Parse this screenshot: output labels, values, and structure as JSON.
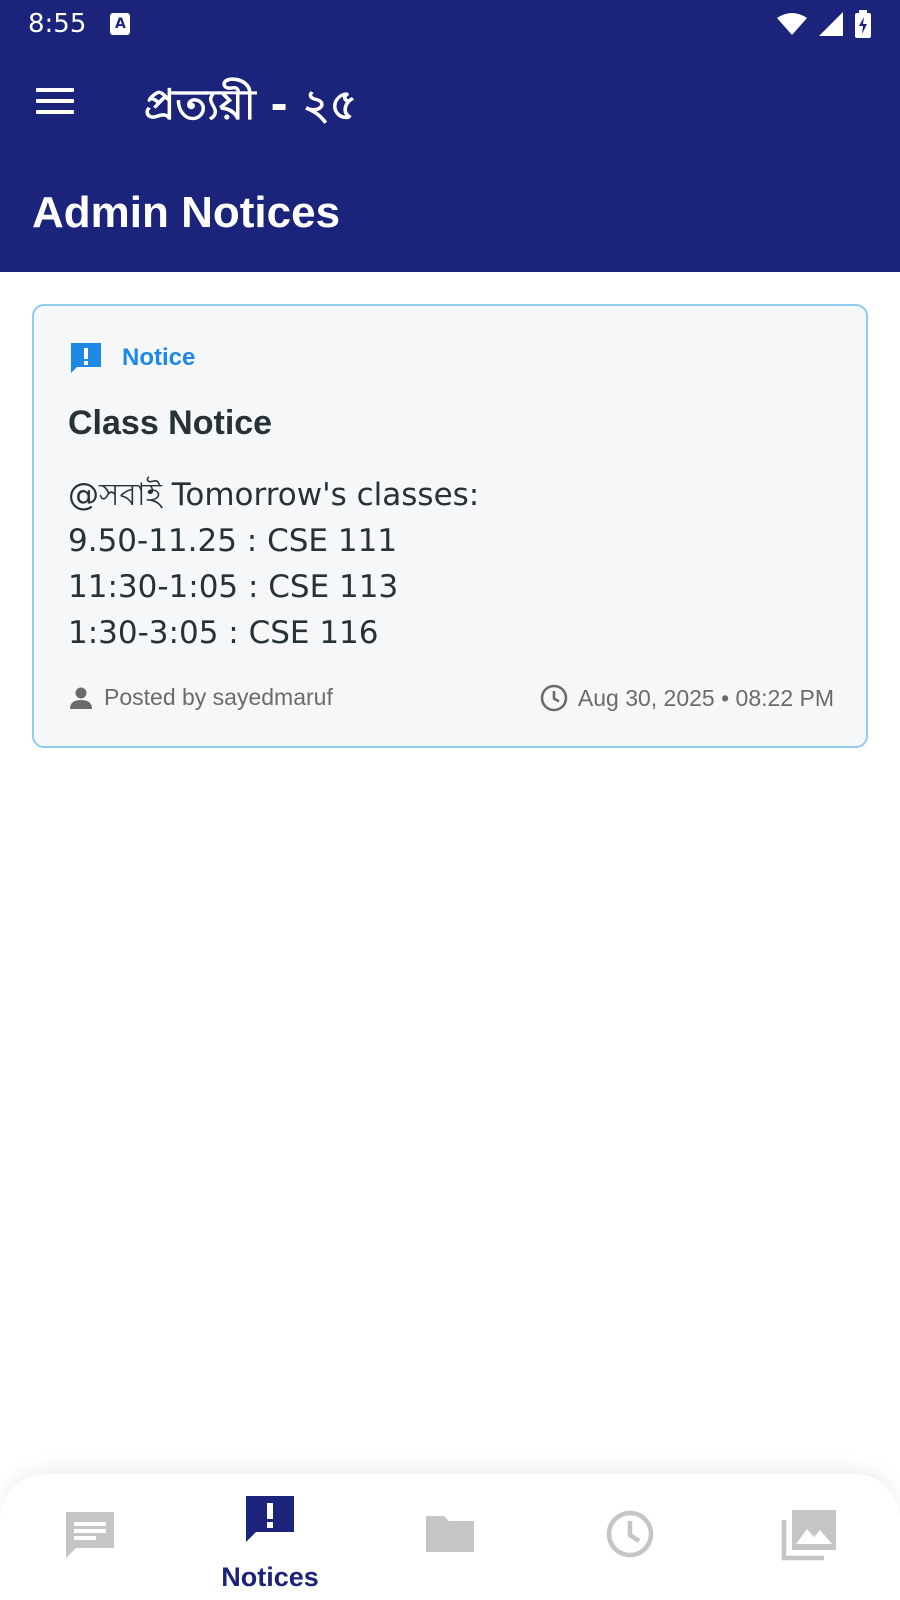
{
  "status_bar": {
    "time": "8:55",
    "a_badge": "A"
  },
  "app_bar": {
    "title": "প্রত্যয়ী - ২৫",
    "menu_icon": "menu-icon"
  },
  "header": {
    "title": "Admin Notices"
  },
  "notice": {
    "tag": "Notice",
    "tag_icon": "notice-icon",
    "title": "Class Notice",
    "body_lines": [
      "@সবাই Tomorrow's classes:",
      "9.50-11.25 : CSE 111",
      "11:30-1:05 : CSE 113",
      "1:30-3:05 : CSE 116"
    ],
    "posted_by": "Posted by sayedmaruf",
    "timestamp": "Aug 30, 2025 • 08:22 PM"
  },
  "bottom_nav": {
    "items": [
      {
        "icon": "chat-icon",
        "label": "",
        "active": false
      },
      {
        "icon": "notice-icon",
        "label": "Notices",
        "active": true
      },
      {
        "icon": "folder-icon",
        "label": "",
        "active": false
      },
      {
        "icon": "clock-icon",
        "label": "",
        "active": false
      },
      {
        "icon": "gallery-icon",
        "label": "",
        "active": false
      }
    ]
  },
  "colors": {
    "primary": "#1b237b",
    "accent": "#1e88e5",
    "card_border": "#90cbf0",
    "inactive_icon": "#c5c5c5"
  }
}
